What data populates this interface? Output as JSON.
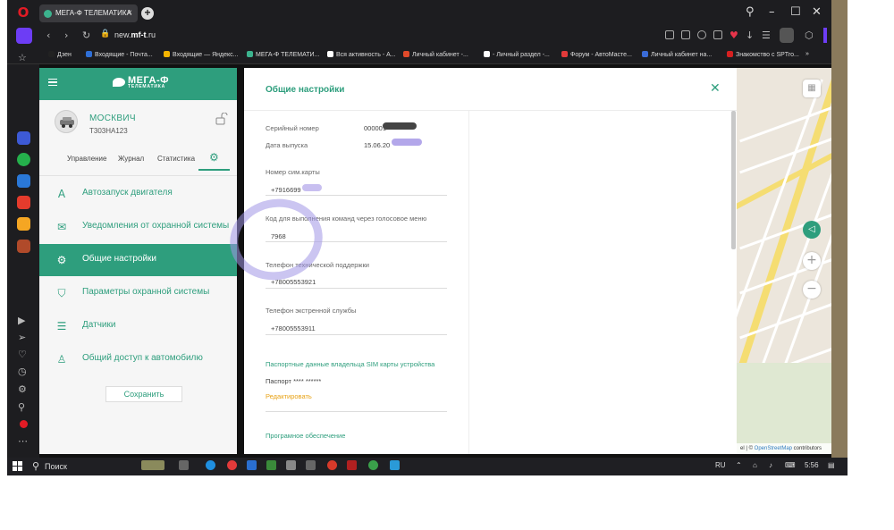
{
  "browser": {
    "tab_title": "МЕГА-Ф ТЕЛЕМАТИКА",
    "url_prefix": "new.",
    "url_domain": "mf-t",
    "url_suffix": ".ru",
    "bookmarks": [
      {
        "label": "Дзен",
        "color": "#222222"
      },
      {
        "label": "Входящие - Почта...",
        "color": "#2f6fd6"
      },
      {
        "label": "Входящие — Яндекс...",
        "color": "#f5b400"
      },
      {
        "label": "МЕГА-Ф ТЕЛЕМАТИ...",
        "color": "#3cb38e"
      },
      {
        "label": "Вся активность - А...",
        "color": "#ffffff"
      },
      {
        "label": "Личный кабинет -...",
        "color": "#e04a2a"
      },
      {
        "label": "- Личный раздел -...",
        "color": "#ffffff"
      },
      {
        "label": "Форум - АвтоМасте...",
        "color": "#e23a3a"
      },
      {
        "label": "Личный кабинет на...",
        "color": "#3a6bd6"
      },
      {
        "label": "Знакомство с SPTro...",
        "color": "#d62020"
      }
    ]
  },
  "app": {
    "logo": "МЕГА-Ф",
    "logo_sub": "ТЕЛЕМАТИКА",
    "car": {
      "name": "МОСКВИЧ",
      "plate": "Т303НА123"
    },
    "subtabs": [
      "Управление",
      "Журнал",
      "Статистика"
    ],
    "menu": [
      {
        "label": "Автозапуск двигателя",
        "icon": "A"
      },
      {
        "label": "Уведомления от охранной системы",
        "icon": "✉"
      },
      {
        "label": "Общие настройки",
        "icon": "⚙"
      },
      {
        "label": "Параметры охранной системы",
        "icon": "⛉"
      },
      {
        "label": "Датчики",
        "icon": "☰"
      },
      {
        "label": "Общий доступ к автомобилю",
        "icon": "♙"
      }
    ],
    "save_label": "Сохранить"
  },
  "settings": {
    "title": "Общие настройки",
    "serial_label": "Серийный номер",
    "serial_value": "000001",
    "release_label": "Дата выпуска",
    "release_value": "15.06.20",
    "sim_label": "Номер сим.карты",
    "sim_value": "+7916699",
    "voice_label": "Код для выполнения команд через голосовое меню",
    "voice_value": "7968",
    "support_label": "Телефон технической поддержки",
    "support_value": "+78005553921",
    "emergency_label": "Телефон экстренной службы",
    "emergency_value": "+78005553911",
    "passport_link": "Паспортные данные владельца SIM карты устройства",
    "passport_label": "Паспорт **** ******",
    "edit_link": "Редактировать",
    "software_link": "Програмное обеспечение"
  },
  "map": {
    "credit_prefix": "el | © ",
    "credit_link": "OpenStreetMap",
    "credit_suffix": " contributors"
  },
  "taskbar": {
    "search": "Поиск",
    "lang": "RU",
    "time": "5:56"
  }
}
